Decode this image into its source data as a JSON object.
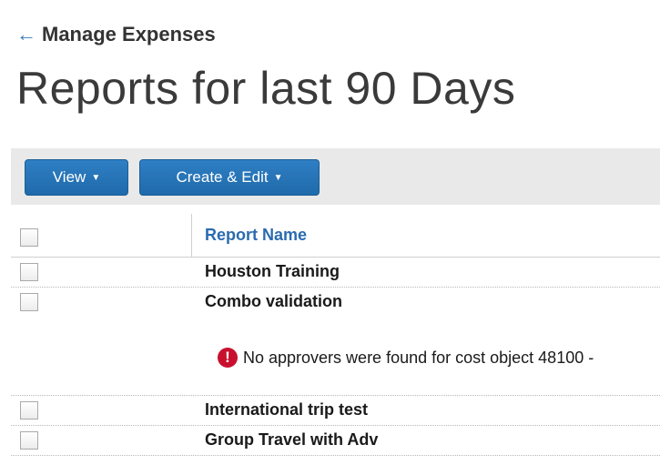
{
  "header": {
    "back_label": "Manage Expenses",
    "back_icon": "left-arrow-icon",
    "title": "Reports for last 90 Days"
  },
  "toolbar": {
    "view_label": "View",
    "create_edit_label": "Create & Edit",
    "caret_icon": "caret-down-icon",
    "button_color": "#2a76bb"
  },
  "table": {
    "columns": [
      "Report Name"
    ],
    "rows": [
      {
        "name": "Houston Training"
      },
      {
        "name": "Combo validation",
        "warning": "No approvers were found for cost object 48100 -"
      },
      {
        "name": "International trip test"
      },
      {
        "name": "Group Travel with Adv"
      }
    ],
    "warning_color": "#c8102e",
    "header_link_color": "#2a6bb0"
  }
}
